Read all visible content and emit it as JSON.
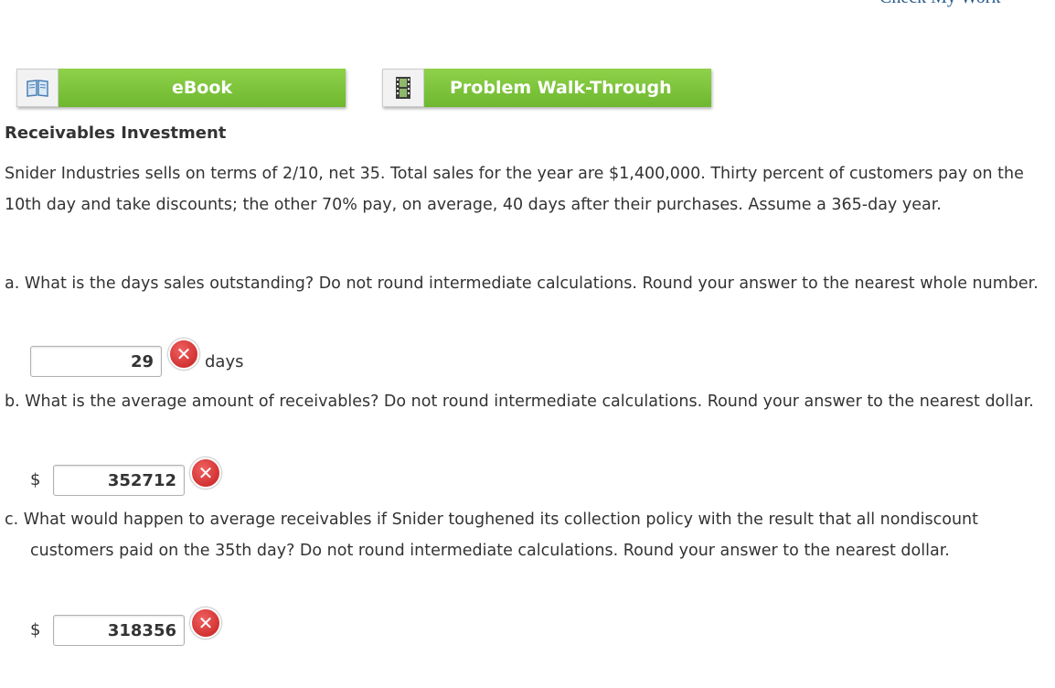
{
  "header": {
    "check_my_work": "Check My Work"
  },
  "resources": {
    "ebook": {
      "label": "eBook",
      "icon": "book-icon"
    },
    "walkthrough": {
      "label": "Problem Walk-Through",
      "icon": "film-icon"
    }
  },
  "problem": {
    "title": "Receivables Investment",
    "intro": "Snider Industries sells on terms of 2/10, net 35. Total sales for the year are $1,400,000. Thirty percent of customers pay on the 10th day and take discounts; the other 70% pay, on average, 40 days after their purchases. Assume a 365-day year."
  },
  "questions": {
    "a": {
      "text": "a. What is the days sales outstanding? Do not round intermediate calculations. Round your answer to the nearest whole number.",
      "answer": "29",
      "unit": "days",
      "status": "incorrect"
    },
    "b": {
      "text": "b. What is the average amount of receivables? Do not round intermediate calculations. Round your answer to the nearest dollar.",
      "currency": "$",
      "answer": "352712",
      "status": "incorrect"
    },
    "c": {
      "text": "c. What would happen to average receivables if Snider toughened its collection policy with the result that all nondiscount customers paid on the 35th day? Do not round intermediate calculations. Round your answer to the nearest dollar.",
      "currency": "$",
      "answer": "318356",
      "status": "incorrect"
    }
  },
  "colors": {
    "button_green": "#7dc53b",
    "error_red": "#d32f2f",
    "link_blue": "#2a5d8f"
  }
}
